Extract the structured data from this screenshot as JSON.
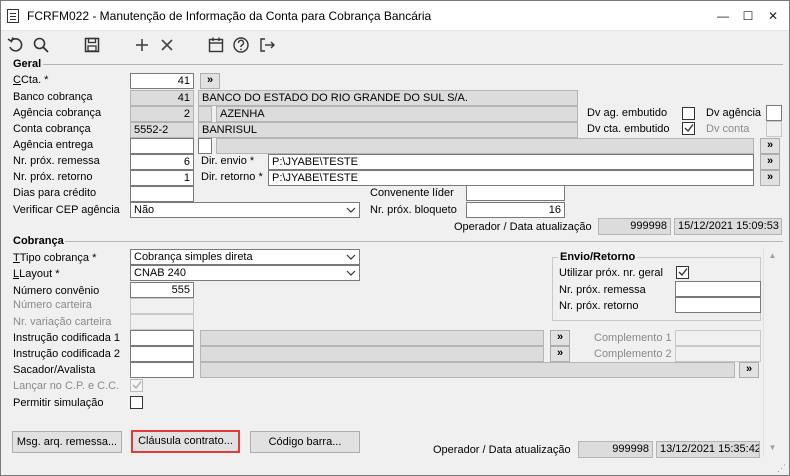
{
  "window": {
    "title": "FCRFM022 - Manutenção de Informação da Conta para Cobrança Bancária",
    "minimize": "—",
    "maximize": "☐",
    "close": "✕"
  },
  "toolbar": [
    "undo-icon",
    "search-icon",
    "save-icon",
    "add-icon",
    "delete-icon",
    "calendar-icon",
    "help-icon",
    "exit-icon"
  ],
  "geral": {
    "title": "Geral",
    "cta_label": "Cta. *",
    "cta_value": "41",
    "cta_button": "»",
    "banco_label": "Banco cobrança",
    "banco_code": "41",
    "banco_name": "BANCO DO ESTADO DO RIO GRANDE DO SUL S/A.",
    "agencia_label": "Agência cobrança",
    "agencia_code": "2",
    "agencia_name": "AZENHA",
    "dv_ag_embutido_label": "Dv ag. embutido",
    "dv_agencia_label": "Dv agência",
    "conta_label": "Conta cobrança",
    "conta_value": "5552-2",
    "conta_name": "BANRISUL",
    "dv_cta_embutido_label": "Dv cta. embutido",
    "dv_conta_label": "Dv conta",
    "agencia_entrega_label": "Agência entrega",
    "agencia_entrega_button": "»",
    "nr_prox_remessa_label": "Nr. próx. remessa",
    "nr_prox_remessa_value": "6",
    "dir_envio_label": "Dir. envio *",
    "dir_envio_value": "P:\\JYABE\\TESTE",
    "dir_envio_button": "»",
    "nr_prox_retorno_label": "Nr. próx. retorno",
    "nr_prox_retorno_value": "1",
    "dir_retorno_label": "Dir. retorno *",
    "dir_retorno_value": "P:\\JYABE\\TESTE",
    "dir_retorno_button": "»",
    "dias_credito_label": "Dias para crédito",
    "convenente_label": "Convenente líder",
    "verificar_cep_label": "Verificar CEP agência",
    "verificar_cep_value": "Não",
    "nr_prox_bloqueto_label": "Nr. próx. bloqueto",
    "nr_prox_bloqueto_value": "16",
    "operador_label": "Operador / Data atualização",
    "operador_value": "999998",
    "data_value": "15/12/2021 15:09:53"
  },
  "cobranca": {
    "title": "Cobrança",
    "tipo_label": "Tipo cobrança *",
    "tipo_value": "Cobrança simples direta",
    "layout_label": "Layout *",
    "layout_value": "CNAB 240",
    "numero_convenio_label": "Número convênio",
    "numero_convenio_value": "555",
    "numero_carteira_label": "Número carteira",
    "nr_variacao_label": "Nr. variação carteira",
    "instrucao1_label": "Instrução codificada 1",
    "instrucao1_button": "»",
    "complemento1_label": "Complemento 1",
    "instrucao2_label": "Instrução codificada 2",
    "instrucao2_button": "»",
    "complemento2_label": "Complemento 2",
    "sacador_label": "Sacador/Avalista",
    "sacador_button": "»",
    "lancar_label": "Lançar no C.P. e C.C.",
    "permitir_label": "Permitir simulação",
    "envio_retorno_title": "Envio/Retorno",
    "utilizar_label": "Utilizar próx. nr. geral",
    "nr_prox_remessa_label": "Nr. próx. remessa",
    "nr_prox_retorno_label": "Nr. próx. retorno"
  },
  "buttons": {
    "msg_arq": "Msg. arq. remessa...",
    "clausula": "Cláusula contrato...",
    "codigo_barra": "Código barra..."
  },
  "footer": {
    "operador_label": "Operador / Data atualização",
    "operador_value": "999998",
    "data_value": "13/12/2021 15:35:42"
  }
}
